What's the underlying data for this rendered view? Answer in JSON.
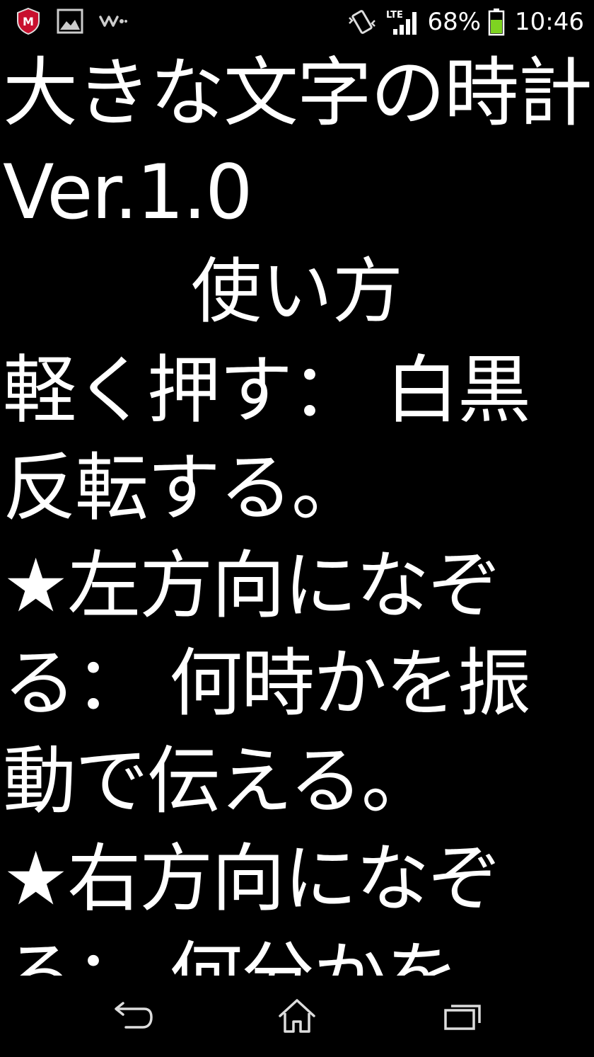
{
  "status_bar": {
    "icons_left": [
      "mcafee-icon",
      "gallery-icon",
      "walkman-icon"
    ],
    "icons_right": [
      "vibrate-icon",
      "lte-signal-icon",
      "battery-icon"
    ],
    "network_label": "LTE",
    "battery_percent": "68%",
    "battery_level": 0.68,
    "time": "10:46",
    "battery_color": "#7ed321"
  },
  "content": {
    "title": "大きな文字の時計 Ver.1.0",
    "heading": "使い方",
    "paragraphs": [
      "軽く押す： 白黒反転する。",
      "★左方向になぞる： 何時かを振動で伝える。",
      "★右方向になぞる： 何分かを"
    ]
  },
  "nav_bar": {
    "buttons": [
      "back-icon",
      "home-icon",
      "recents-icon"
    ]
  },
  "colors": {
    "background": "#000000",
    "text": "#ffffff"
  }
}
